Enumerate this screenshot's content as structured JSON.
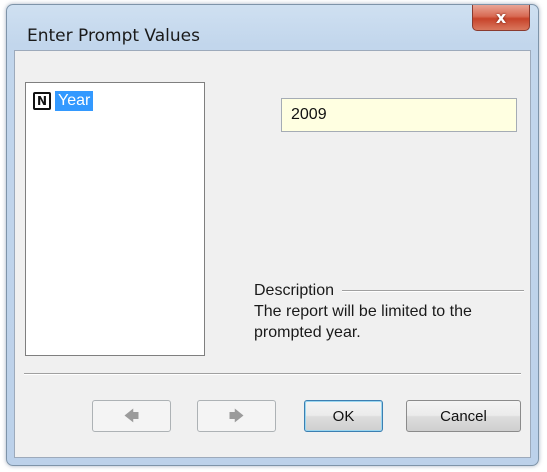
{
  "window": {
    "title": "Enter Prompt Values",
    "close_icon": "close-icon",
    "close_glyph": "x"
  },
  "prompts": {
    "items": [
      {
        "type_icon": "N",
        "label": "Year",
        "selected": true
      }
    ]
  },
  "value_field": {
    "value": "2009"
  },
  "description": {
    "header": "Description",
    "text": "The report will be limited to the prompted year."
  },
  "buttons": {
    "back_icon": "arrow-left-icon",
    "back_glyph": "🡄",
    "forward_icon": "arrow-right-icon",
    "forward_glyph": "🡆",
    "ok_label": "OK",
    "cancel_label": "Cancel"
  },
  "colors": {
    "selection": "#3399ff",
    "input_background": "#ffffe1",
    "close_button": "#c7432a"
  }
}
